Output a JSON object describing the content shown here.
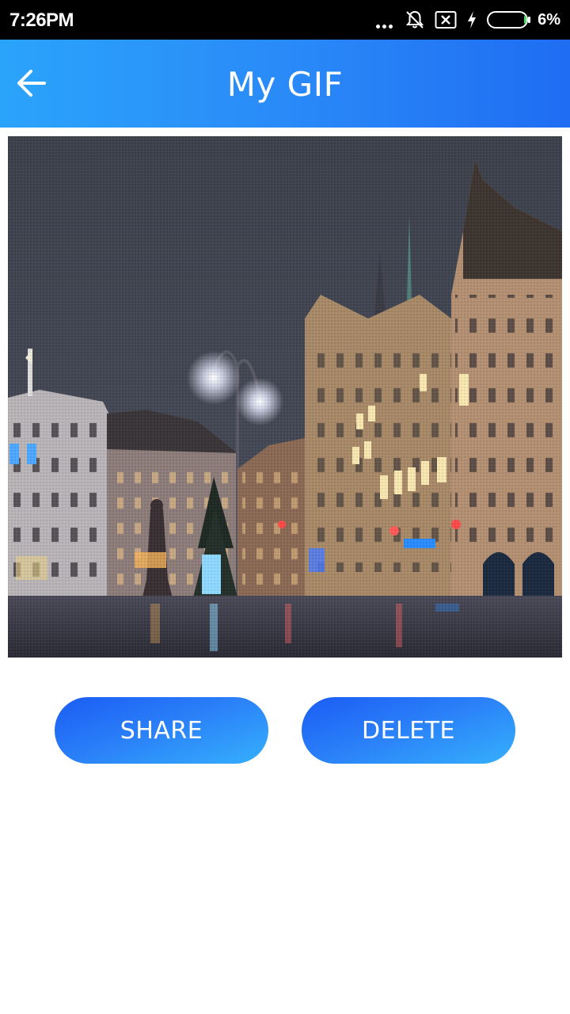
{
  "status_bar": {
    "time": "7:26PM",
    "battery_percent": "6%",
    "icons": [
      "more-dots-icon",
      "notifications-off-icon",
      "sim-x-icon",
      "charging-bolt-icon",
      "battery-icon"
    ]
  },
  "app_bar": {
    "title": "My GIF",
    "back_icon": "arrow-left-icon",
    "gradient": [
      "#2aa4fb",
      "#1f6df2"
    ]
  },
  "preview": {
    "content": "gif-image"
  },
  "actions": {
    "share_label": "SHARE",
    "delete_label": "DELETE",
    "button_color": "#2a7ef8"
  }
}
